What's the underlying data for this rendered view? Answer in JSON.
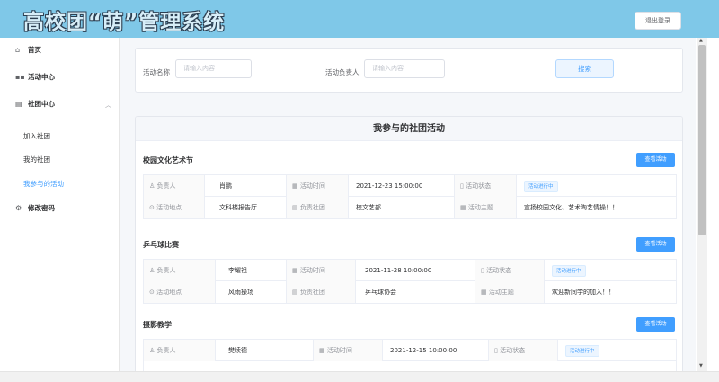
{
  "header": {
    "title": "高校团“萌”管理系统",
    "logout_label": "退出登录"
  },
  "sidebar": {
    "home": "首页",
    "activity_center": "活动中心",
    "club_center": "社团中心",
    "join_club": "加入社团",
    "my_clubs": "我的社团",
    "my_activities": "我参与的活动",
    "change_password": "修改密码"
  },
  "search": {
    "name_label": "活动名称",
    "name_placeholder": "请输入内容",
    "leader_label": "活动负责人",
    "leader_placeholder": "请输入内容",
    "search_button": "搜索"
  },
  "list": {
    "title": "我参与的社团活动",
    "view_button": "查看活动",
    "labels": {
      "leader": "负责人",
      "time": "活动时间",
      "status": "活动状态",
      "location": "活动地点",
      "club": "负责社团",
      "theme": "活动主题"
    },
    "activities": [
      {
        "name": "校园文化艺术节",
        "leader": "肖鹏",
        "time": "2021-12-23 15:00:00",
        "status": "活动进行中",
        "location": "文科楼报告厅",
        "club": "校文艺部",
        "theme": "宣扬校园文化、艺术陶艺情操！！"
      },
      {
        "name": "乒乓球比赛",
        "leader": "李耀祖",
        "time": "2021-11-28 10:00:00",
        "status": "活动进行中",
        "location": "风雨操场",
        "club": "乒乓球协会",
        "theme": "欢迎新同学的加入！！"
      },
      {
        "name": "摄影教学",
        "leader": "樊续德",
        "time": "2021-12-15 10:00:00",
        "status": "活动进行中",
        "location": "",
        "club": "",
        "theme": ""
      }
    ]
  }
}
